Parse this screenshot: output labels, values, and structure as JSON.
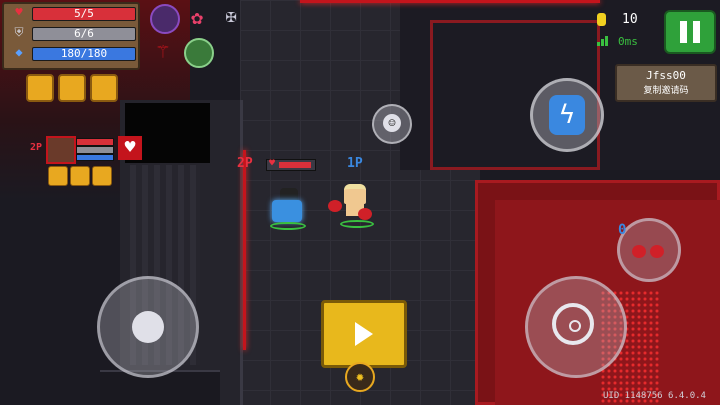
{
  "hud": {
    "hp": "5/5",
    "armor": "6/6",
    "energy": "180/180",
    "coins": "10",
    "ping": "0ms",
    "player_name": "Jfss00",
    "copy_code_label": "复制邀请码",
    "version": "UID 1148756 6.4.0.4",
    "p2_tag": "2P",
    "p1_tag": "1P",
    "teammate_tag": "2P",
    "weapon_ammo": "0"
  },
  "colors": {
    "hp_bar": "#d8303a",
    "armor_bar": "#8f8f98",
    "energy_bar": "#3a78e0",
    "accent_gold": "#e8b81c",
    "pause_green": "#2fa13a",
    "red_glow": "#c4141c"
  },
  "icons": {
    "hp": "heart-icon",
    "armor": "shield-icon",
    "energy": "diamond-icon",
    "coin": "coin-icon",
    "signal": "signal-icon",
    "skill": "lightning-icon",
    "emote": "smile-icon",
    "aim": "crosshair-icon",
    "play": "play-icon",
    "pause": "pause-icon",
    "weapon_swap": "boxing-gloves-icon"
  }
}
